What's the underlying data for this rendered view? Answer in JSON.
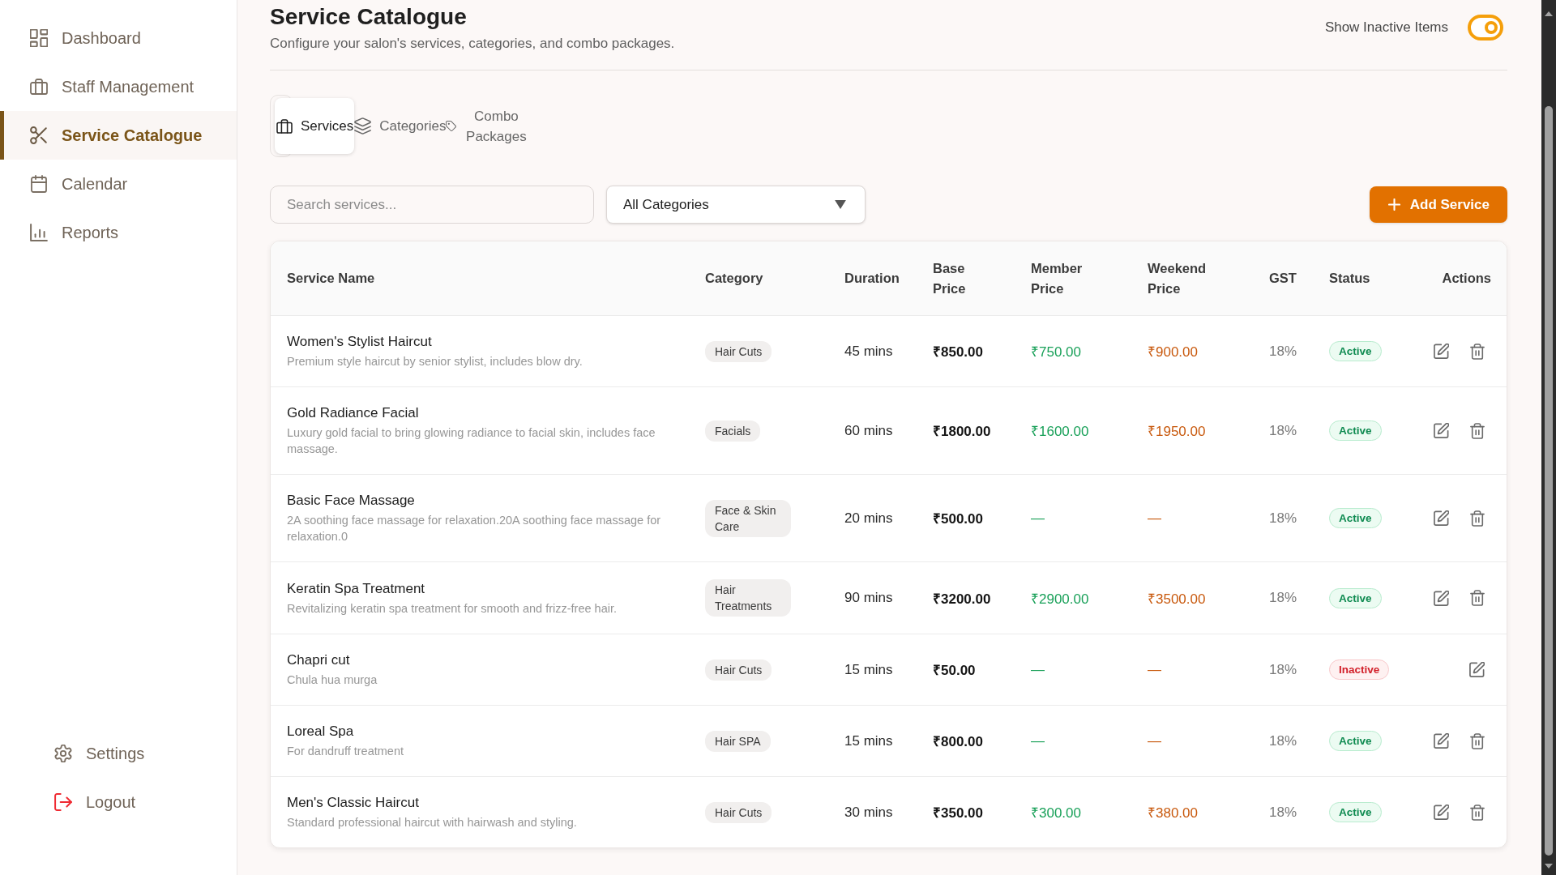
{
  "sidebar": {
    "items": [
      {
        "label": "Dashboard",
        "selected": false
      },
      {
        "label": "Staff Management",
        "selected": false
      },
      {
        "label": "Service Catalogue",
        "selected": true
      },
      {
        "label": "Calendar",
        "selected": false
      },
      {
        "label": "Reports",
        "selected": false
      }
    ],
    "footer_items": [
      {
        "label": "Settings"
      },
      {
        "label": "Logout"
      }
    ]
  },
  "header": {
    "title": "Service Catalogue",
    "subtitle": "Configure your salon's services, categories, and combo packages.",
    "show_inactive": {
      "label": "Show Inactive Items",
      "on": true
    }
  },
  "tabs": [
    {
      "label": "Services",
      "selected": true
    },
    {
      "label": "Categories",
      "selected": false
    },
    {
      "label": "Combo Packages",
      "selected": false
    }
  ],
  "toolbar": {
    "search": {
      "placeholder": "Search services..."
    },
    "category_filter": {
      "value": "All Categories"
    },
    "add_button": {
      "label": "Add Service"
    }
  },
  "table": {
    "columns": [
      "Service Name",
      "Category",
      "Duration",
      "Base Price",
      "Member Price",
      "Weekend Price",
      "GST",
      "Status",
      "Actions"
    ],
    "rows": [
      {
        "name": "Women's Stylist Haircut",
        "description": "Premium style haircut by senior stylist, includes blow dry.",
        "category": "Hair Cuts",
        "duration": "45 mins",
        "base_price": "₹850.00",
        "member_price": "₹750.00",
        "weekend_price": "₹900.00",
        "gst": "18%",
        "status": {
          "label": "Active",
          "active": true
        },
        "actions": [
          {
            "kind": "edit"
          },
          {
            "kind": "delete"
          }
        ]
      },
      {
        "name": "Gold Radiance Facial",
        "description": "Luxury gold facial to bring glowing radiance to facial skin, includes face massage.",
        "category": "Facials",
        "duration": "60 mins",
        "base_price": "₹1800.00",
        "member_price": "₹1600.00",
        "weekend_price": "₹1950.00",
        "gst": "18%",
        "status": {
          "label": "Active",
          "active": true
        },
        "actions": [
          {
            "kind": "edit"
          },
          {
            "kind": "delete"
          }
        ]
      },
      {
        "name": "Basic Face Massage",
        "description": "2A soothing face massage for relaxation.20A soothing face massage for relaxation.0",
        "category": "Face & Skin Care",
        "duration": "20 mins",
        "base_price": "₹500.00",
        "member_price": "—",
        "weekend_price": "—",
        "gst": "18%",
        "status": {
          "label": "Active",
          "active": true
        },
        "actions": [
          {
            "kind": "edit"
          },
          {
            "kind": "delete"
          }
        ]
      },
      {
        "name": "Keratin Spa Treatment",
        "description": "Revitalizing keratin spa treatment for smooth and frizz-free hair.",
        "category": "Hair Treatments",
        "duration": "90 mins",
        "base_price": "₹3200.00",
        "member_price": "₹2900.00",
        "weekend_price": "₹3500.00",
        "gst": "18%",
        "status": {
          "label": "Active",
          "active": true
        },
        "actions": [
          {
            "kind": "edit"
          },
          {
            "kind": "delete"
          }
        ]
      },
      {
        "name": "Chapri cut",
        "description": "Chula hua murga",
        "category": "Hair Cuts",
        "duration": "15 mins",
        "base_price": "₹50.00",
        "member_price": "—",
        "weekend_price": "—",
        "gst": "18%",
        "status": {
          "label": "Inactive",
          "active": false
        },
        "actions": [
          {
            "kind": "edit"
          }
        ]
      },
      {
        "name": "Loreal Spa",
        "description": "For dandruff treatment",
        "category": "Hair SPA",
        "duration": "15 mins",
        "base_price": "₹800.00",
        "member_price": "—",
        "weekend_price": "—",
        "gst": "18%",
        "status": {
          "label": "Active",
          "active": true
        },
        "actions": [
          {
            "kind": "edit"
          },
          {
            "kind": "delete"
          }
        ]
      },
      {
        "name": "Men's Classic Haircut",
        "description": "Standard professional haircut with hairwash and styling.",
        "category": "Hair Cuts",
        "duration": "30 mins",
        "base_price": "₹350.00",
        "member_price": "₹300.00",
        "weekend_price": "₹380.00",
        "gst": "18%",
        "status": {
          "label": "Active",
          "active": true
        },
        "actions": [
          {
            "kind": "edit"
          },
          {
            "kind": "delete"
          }
        ]
      }
    ]
  }
}
